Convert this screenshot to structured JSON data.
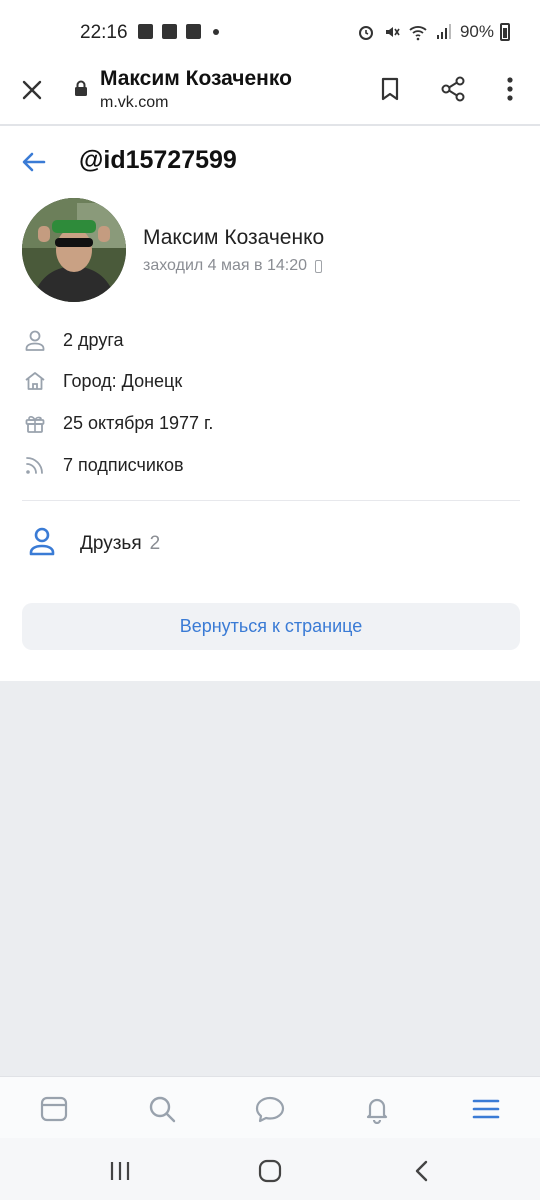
{
  "status_bar": {
    "time": "22:16",
    "battery": "90%",
    "left_icons": [
      "facebook-icon",
      "image-icon",
      "facebook-icon",
      "dot-icon"
    ],
    "right_icons": [
      "alarm-icon",
      "mute-icon",
      "wifi-icon",
      "signal-icon",
      "battery-icon"
    ]
  },
  "browser": {
    "title": "Максим Козаченко",
    "url": "m.vk.com"
  },
  "profile": {
    "handle": "@id15727599",
    "name": "Максим Козаченко",
    "last_seen": "заходил 4 мая в 14:20"
  },
  "info": [
    {
      "icon": "user-icon",
      "text": "2 друга"
    },
    {
      "icon": "home-icon",
      "text": "Город: Донецк"
    },
    {
      "icon": "gift-icon",
      "text": "25 октября 1977 г."
    },
    {
      "icon": "rss-icon",
      "text": "7 подписчиков"
    }
  ],
  "friends": {
    "label": "Друзья",
    "count": "2"
  },
  "return_button": "Вернуться к странице",
  "colors": {
    "accent": "#3a7bd5",
    "secondary_text": "#8a8d93",
    "background": "#ebedf0"
  },
  "tabs": [
    "feed-icon",
    "search-icon",
    "messages-icon",
    "notifications-icon",
    "menu-icon"
  ],
  "system_nav": [
    "recent-apps-icon",
    "home-button-icon",
    "back-icon"
  ]
}
